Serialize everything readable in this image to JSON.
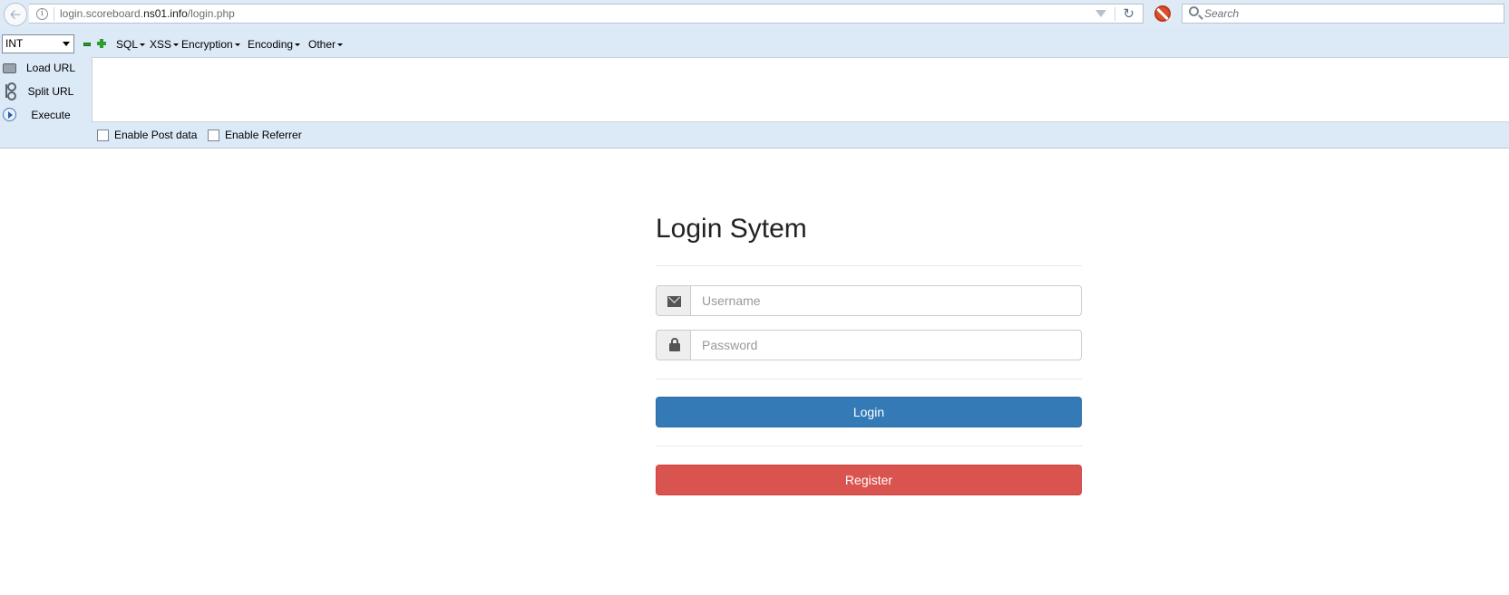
{
  "browser": {
    "url": {
      "prefix": "login.scoreboard.",
      "host": "ns01.info",
      "path": "/login.php"
    },
    "search_placeholder": "Search"
  },
  "hackbar": {
    "select_value": "INT",
    "menus": [
      "SQL",
      "XSS",
      "Encryption",
      "Encoding",
      "Other"
    ],
    "actions": [
      "Load URL",
      "Split URL",
      "Execute"
    ],
    "checkboxes": [
      "Enable Post data",
      "Enable Referrer"
    ]
  },
  "login": {
    "title": "Login Sytem",
    "username_placeholder": "Username",
    "password_placeholder": "Password",
    "login_label": "Login",
    "register_label": "Register"
  }
}
